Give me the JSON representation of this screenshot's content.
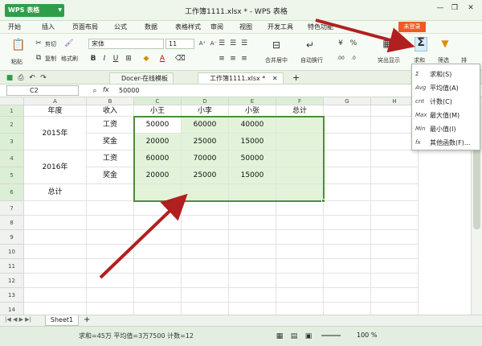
{
  "app": {
    "logo": "WPS 表格",
    "window_title": "工作簿1111.xlsx * - WPS 表格"
  },
  "menu": [
    "开始",
    "插入",
    "页面布局",
    "公式",
    "数据",
    "表格样式",
    "审阅",
    "视图",
    "开发工具",
    "特色功能"
  ],
  "login_label": "未登录",
  "ribbon": {
    "paste_label": "粘贴",
    "cut_label": "剪切",
    "copy_label": "复制",
    "format_painter_label": "格式刷",
    "font_name": "宋体",
    "font_size": "11",
    "merge_center_label": "合并居中",
    "wrap_label": "自动换行",
    "highlight_label": "突出显示",
    "sum_label": "求和",
    "filter_label": "筛选",
    "sort_label": "排"
  },
  "tabs": {
    "template_tab": "Docer-在线模板",
    "doc_tab": "工作簿1111.xlsx *",
    "add": "+"
  },
  "formula_bar": {
    "cell_ref": "C2",
    "fx": "fx",
    "value": "50000"
  },
  "grid": {
    "columns": [
      "A",
      "B",
      "C",
      "D",
      "E",
      "F",
      "G",
      "H"
    ],
    "rows": [
      "1",
      "2",
      "3",
      "4",
      "5",
      "6",
      "7",
      "8",
      "9",
      "10",
      "11",
      "12",
      "13",
      "14"
    ],
    "cells": {
      "A1": "年度",
      "B1": "收入",
      "C1": "小王",
      "D1": "小李",
      "E1": "小张",
      "F1": "总计",
      "A2": "2015年",
      "B2": "工资",
      "C2": "50000",
      "D2": "60000",
      "E2": "40000",
      "B3": "奖金",
      "C3": "20000",
      "D3": "25000",
      "E3": "15000",
      "A4": "2016年",
      "B4": "工资",
      "C4": "60000",
      "D4": "70000",
      "E4": "50000",
      "B5": "奖金",
      "C5": "20000",
      "D5": "25000",
      "E5": "15000",
      "A6": "总计"
    }
  },
  "dropdown": [
    {
      "icon": "Σ",
      "label": "求和(S)"
    },
    {
      "icon": "Avg",
      "label": "平均值(A)"
    },
    {
      "icon": "cnt",
      "label": "计数(C)"
    },
    {
      "icon": "Max",
      "label": "最大值(M)"
    },
    {
      "icon": "Min",
      "label": "最小值(I)"
    },
    {
      "icon": "fx",
      "label": "其他函数(F)..."
    }
  ],
  "sheet_tab": "Sheet1",
  "status": "求和=45万  平均值=3万7500  计数=12",
  "zoom": "100 %",
  "colors": {
    "accent": "#2f9e4a",
    "selection": "#4e8c3a",
    "arrow": "#b21f1f",
    "login": "#f15a24"
  }
}
